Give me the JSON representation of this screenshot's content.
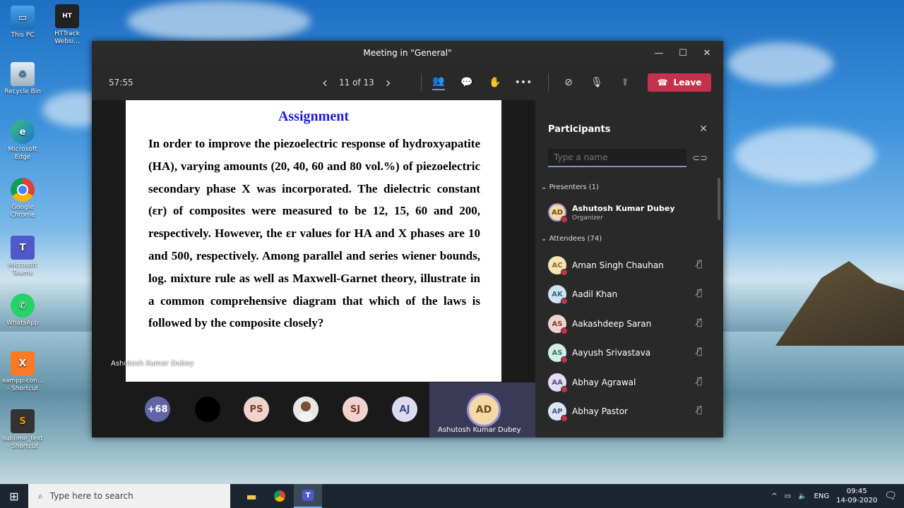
{
  "desktop": {
    "icons": [
      {
        "label": "This PC",
        "icon": "computer-icon"
      },
      {
        "label": "HTTrack\nWebsi...",
        "icon": "httrack-icon"
      },
      {
        "label": "Recycle Bin",
        "icon": "recycle-bin-icon"
      },
      {
        "label": "Microsoft\nEdge",
        "icon": "edge-icon"
      },
      {
        "label": "Google\nChrome",
        "icon": "chrome-icon"
      },
      {
        "label": "Microsoft\nTeams",
        "icon": "teams-icon"
      },
      {
        "label": "WhatsApp",
        "icon": "whatsapp-icon"
      },
      {
        "label": "xampp-con...\n- Shortcut",
        "icon": "xampp-icon"
      },
      {
        "label": "sublime_text\n- Shortcut",
        "icon": "sublime-icon"
      }
    ]
  },
  "window": {
    "title": "Meeting in \"General\"",
    "timer": "57:55",
    "slide_counter": "11 of 13",
    "leave_label": "Leave",
    "accent": "#c4314b"
  },
  "slide": {
    "title": "Assignment",
    "text": "In order to improve the piezoelectric response of hydroxyapatite (HA), varying amounts (20, 40, 60 and 80 vol.%) of piezoelectric secondary phase X was incorporated. The dielectric constant (εr) of composites were measured to be 12, 15, 60 and 200, respectively. However, the εr values for HA and X phases are 10 and 500, respectively. Among parallel and series wiener bounds, log. mixture rule as well as Maxwell-Garnet theory, illustrate in a common comprehensive diagram that which of the laws is followed by the composite closely?",
    "presenter": "Ashutosh Kumar Dubey"
  },
  "gallery": {
    "overflow": "+68",
    "tiles": [
      "PS",
      "SJ",
      "AJ"
    ],
    "active": {
      "initials": "AD",
      "name": "Ashutosh Kumar Dubey"
    }
  },
  "participants": {
    "title": "Participants",
    "search_placeholder": "Type a name",
    "presenters_label": "Presenters (1)",
    "attendees_label": "Attendees (74)",
    "presenter": {
      "initials": "AD",
      "name": "Ashutosh Kumar Dubey",
      "role": "Organizer"
    },
    "attendees": [
      {
        "initials": "AC",
        "name": "Aman Singh Chauhan"
      },
      {
        "initials": "AK",
        "name": "Aadil Khan"
      },
      {
        "initials": "AS",
        "name": "Aakashdeep Saran"
      },
      {
        "initials": "AS",
        "name": "Aayush Srivastava"
      },
      {
        "initials": "AA",
        "name": "Abhay Agrawal"
      },
      {
        "initials": "AP",
        "name": "Abhay Pastor"
      }
    ]
  },
  "taskbar": {
    "search_placeholder": "Type here to search",
    "language": "ENG",
    "time": "09:45",
    "date": "14-09-2020"
  }
}
